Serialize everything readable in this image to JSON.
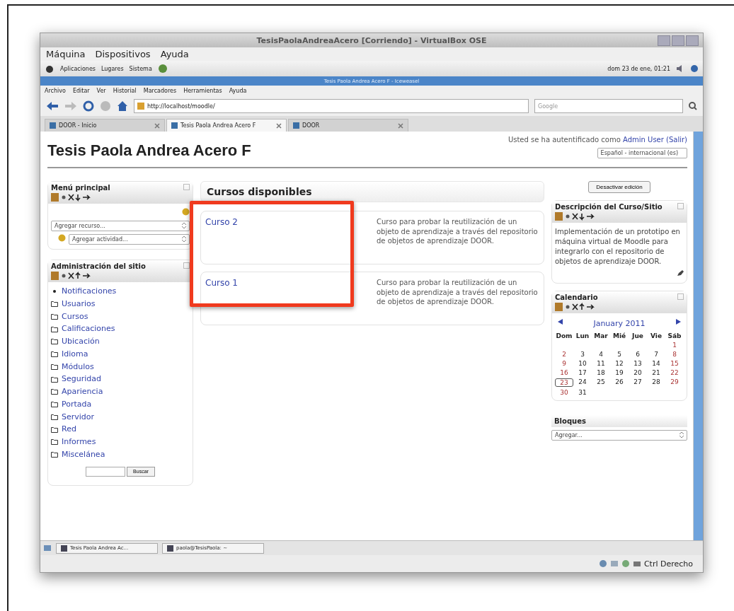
{
  "vbox": {
    "title": "TesisPaolaAndreaAcero [Corriendo] - VirtualBox OSE",
    "menu": [
      "Máquina",
      "Dispositivos",
      "Ayuda"
    ],
    "status_text": "Ctrl Derecho"
  },
  "gnome_panel": {
    "items": [
      "Aplicaciones",
      "Lugares",
      "Sistema"
    ],
    "clock": "dom 23 de ene, 01:21"
  },
  "browser": {
    "title": "Tesis Paola Andrea Acero F - Iceweasel",
    "menu": [
      "Archivo",
      "Editar",
      "Ver",
      "Historial",
      "Marcadores",
      "Herramientas",
      "Ayuda"
    ],
    "url": "http://localhost/moodle/",
    "search_placeholder": "Google",
    "tabs": [
      {
        "label": "DOOR - Inicio",
        "selected": false
      },
      {
        "label": "Tesis Paola Andrea Acero F",
        "selected": true
      },
      {
        "label": "DOOR",
        "selected": false
      }
    ]
  },
  "page": {
    "site_title": "Tesis Paola Andrea Acero F",
    "login_prefix": "Usted se ha autentificado como",
    "login_user": "Admin User",
    "logout": "(Salir)",
    "language": "Español - internacional (es)",
    "main_menu": {
      "title": "Menú principal",
      "resource_select": "Agregar recurso...",
      "activity_select": "Agregar actividad..."
    },
    "admin": {
      "title": "Administración del sitio",
      "items": [
        {
          "label": "Notificaciones",
          "kind": "bullet"
        },
        {
          "label": "Usuarios",
          "kind": "folder"
        },
        {
          "label": "Cursos",
          "kind": "folder"
        },
        {
          "label": "Calificaciones",
          "kind": "folder"
        },
        {
          "label": "Ubicación",
          "kind": "folder"
        },
        {
          "label": "Idioma",
          "kind": "folder"
        },
        {
          "label": "Módulos",
          "kind": "folder"
        },
        {
          "label": "Seguridad",
          "kind": "folder"
        },
        {
          "label": "Apariencia",
          "kind": "folder"
        },
        {
          "label": "Portada",
          "kind": "folder"
        },
        {
          "label": "Servidor",
          "kind": "folder"
        },
        {
          "label": "Red",
          "kind": "folder"
        },
        {
          "label": "Informes",
          "kind": "folder"
        },
        {
          "label": "Miscelánea",
          "kind": "folder"
        }
      ],
      "search_button": "Buscar"
    },
    "courses_heading": "Cursos disponibles",
    "courses": [
      {
        "name": "Curso 2",
        "summary": "Curso para probar la reutilización de un objeto de aprendizaje a través del repositorio de objetos de aprendizaje DOOR."
      },
      {
        "name": "Curso 1",
        "summary": "Curso para probar la reutilización de un objeto de aprendizaje a través del repositorio de objetos de aprendizaje DOOR."
      }
    ],
    "edit_button": "Desactivar edición",
    "description": {
      "title": "Descripción del Curso/Sitio",
      "text": "Implementación de un prototipo en máquina virtual de Moodle para integrarlo con el repositorio de objetos de aprendizaje DOOR."
    },
    "calendar": {
      "title": "Calendario",
      "month": "January 2011",
      "weekdays": [
        "Dom",
        "Lun",
        "Mar",
        "Mié",
        "Jue",
        "Vie",
        "Sáb"
      ],
      "weeks": [
        [
          {
            "d": "1",
            "today": false
          }
        ],
        [
          {
            "d": "2",
            "today": false
          },
          {
            "d": "3",
            "today": false
          },
          {
            "d": "4",
            "today": false
          },
          {
            "d": "5",
            "today": false
          },
          {
            "d": "6",
            "today": false
          },
          {
            "d": "7",
            "today": false
          },
          {
            "d": "8",
            "today": false
          }
        ],
        [
          {
            "d": "9",
            "today": false
          },
          {
            "d": "10",
            "today": false
          },
          {
            "d": "11",
            "today": false
          },
          {
            "d": "12",
            "today": false
          },
          {
            "d": "13",
            "today": false
          },
          {
            "d": "14",
            "today": false
          },
          {
            "d": "15",
            "today": false
          }
        ],
        [
          {
            "d": "16",
            "today": false
          },
          {
            "d": "17",
            "today": false
          },
          {
            "d": "18",
            "today": false
          },
          {
            "d": "19",
            "today": false
          },
          {
            "d": "20",
            "today": false
          },
          {
            "d": "21",
            "today": false
          },
          {
            "d": "22",
            "today": false
          }
        ],
        [
          {
            "d": "23",
            "today": true
          },
          {
            "d": "24",
            "today": false
          },
          {
            "d": "25",
            "today": false
          },
          {
            "d": "26",
            "today": false
          },
          {
            "d": "27",
            "today": false
          },
          {
            "d": "28",
            "today": false
          },
          {
            "d": "29",
            "today": false
          }
        ],
        [
          {
            "d": "30",
            "today": false
          },
          {
            "d": "31",
            "today": false
          }
        ]
      ]
    },
    "blocks": {
      "title": "Bloques",
      "select": "Agregar..."
    }
  },
  "taskbar": [
    "Tesis Paola Andrea Ac...",
    "paola@TesisPaola: ~"
  ]
}
